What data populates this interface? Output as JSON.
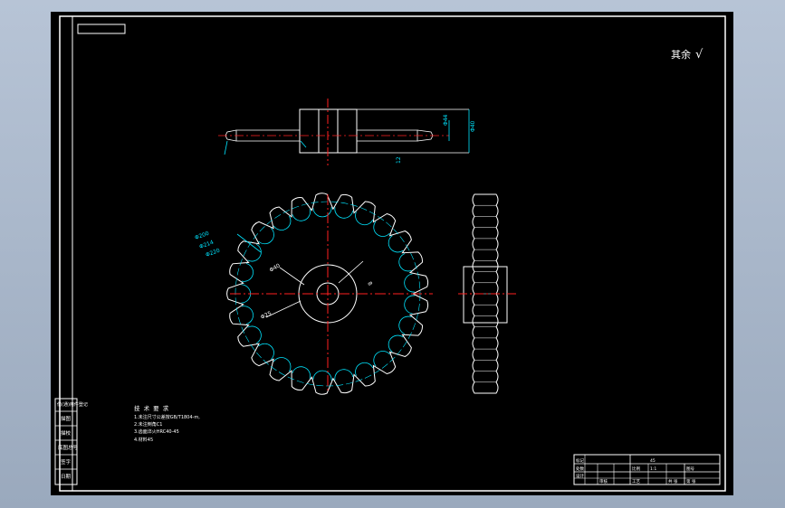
{
  "roughness": {
    "label": "其余",
    "symbol": "√"
  },
  "tech_requirements": {
    "title": "技 术 要 求",
    "lines": [
      "1.未注尺寸公差按GB/T1804-m,",
      "2.未注倒角C1",
      "3.齿面淬火HRC40-45",
      "4.材料45"
    ]
  },
  "side_labels": [
    "借(通)用件登记",
    "描图",
    "描校",
    "底图总号",
    "签字",
    "日期"
  ],
  "title_block": {
    "labels": [
      "标记",
      "处数",
      "设计",
      "审核",
      "工艺",
      "比例",
      "1:1",
      "共 张",
      "第 张",
      "图号",
      "45"
    ]
  },
  "dimensions": {
    "side_view": [
      "Φ40",
      "Φ44",
      "12"
    ],
    "front_view": [
      "Φ200",
      "Φ214",
      "Φ220",
      "Φ40",
      "Φ25",
      "8"
    ]
  },
  "colors": {
    "outline": "#ffffff",
    "dimension": "#00e5ff",
    "centerline": "#ff2020",
    "paper": "#000000"
  }
}
